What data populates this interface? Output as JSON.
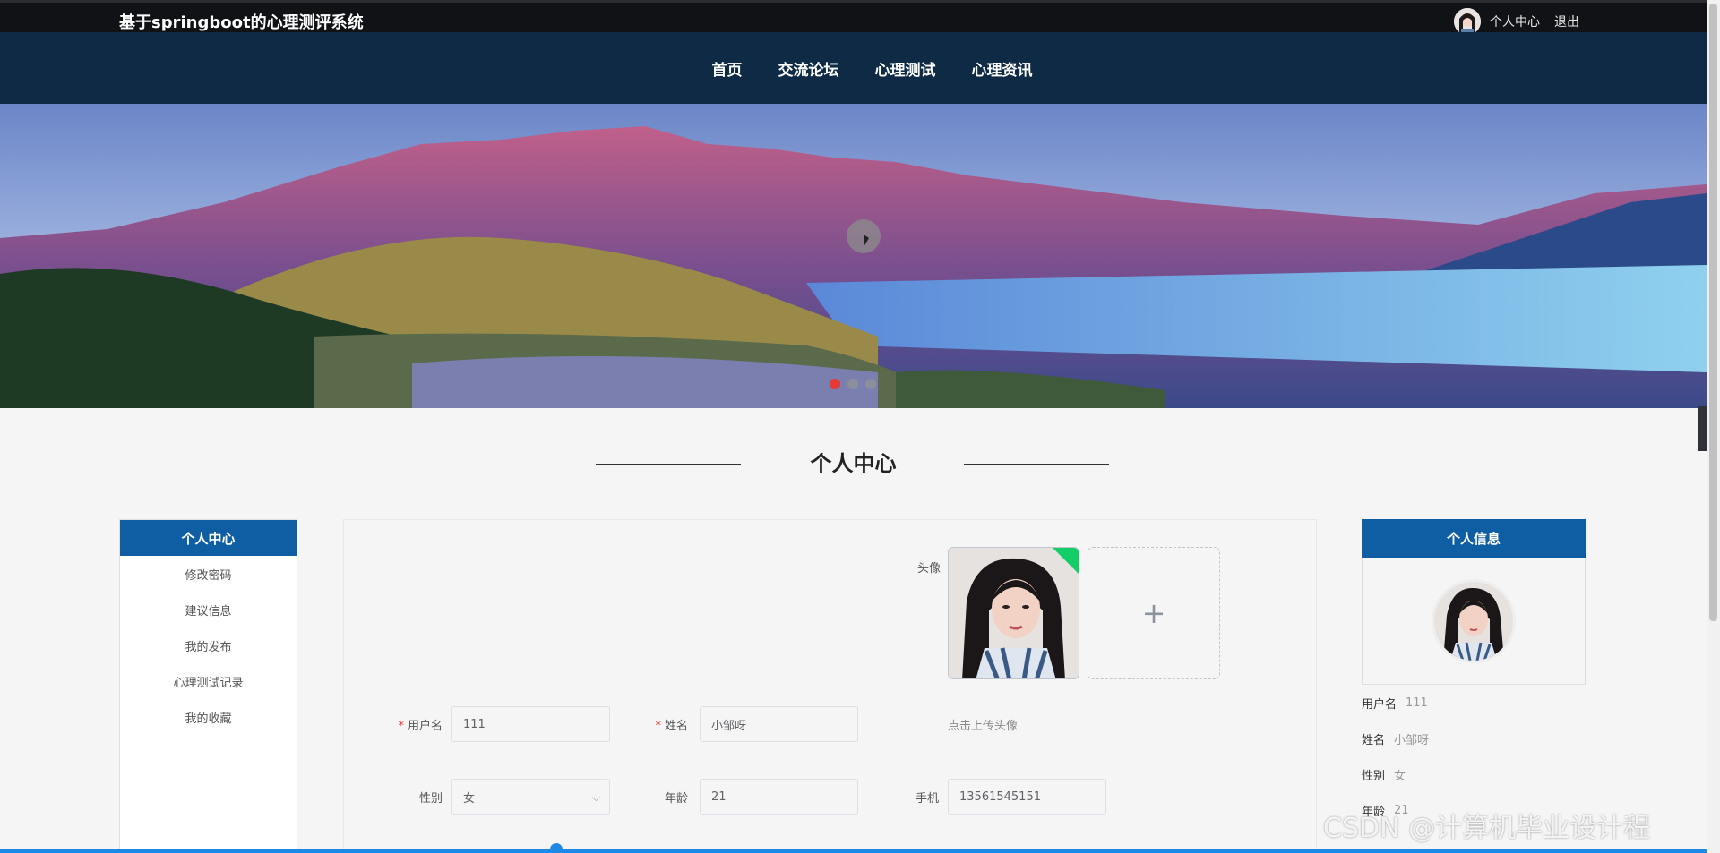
{
  "app": {
    "title": "基于springboot的心理测评系统",
    "user_center": "个人中心",
    "logout": "退出"
  },
  "nav": {
    "items": [
      "首页",
      "交流论坛",
      "心理测试",
      "心理资讯"
    ]
  },
  "banner": {
    "slide_count": 3,
    "active_slide": 0
  },
  "section": {
    "title": "个人中心"
  },
  "sidebar": {
    "header": "个人中心",
    "items": [
      "修改密码",
      "建议信息",
      "我的发布",
      "心理测试记录",
      "我的收藏"
    ]
  },
  "form": {
    "avatar_label": "头像",
    "upload_hint": "点击上传头像",
    "username_label": "用户名",
    "username_value": "111",
    "name_label": "姓名",
    "name_value": "小邹呀",
    "gender_label": "性别",
    "gender_value": "女",
    "age_label": "年龄",
    "age_value": "21",
    "phone_label": "手机",
    "phone_value": "13561545151"
  },
  "profile_card": {
    "header": "个人信息",
    "rows": [
      {
        "key": "用户名",
        "value": "111"
      },
      {
        "key": "姓名",
        "value": "小邹呀"
      },
      {
        "key": "性别",
        "value": "女"
      },
      {
        "key": "年龄",
        "value": "21"
      }
    ]
  },
  "watermark": "CSDN @计算机毕业设计程",
  "colors": {
    "topbar": "#101216",
    "navbar": "#0f2a44",
    "accent": "#0f5ea3",
    "active_dot": "#e53935"
  }
}
